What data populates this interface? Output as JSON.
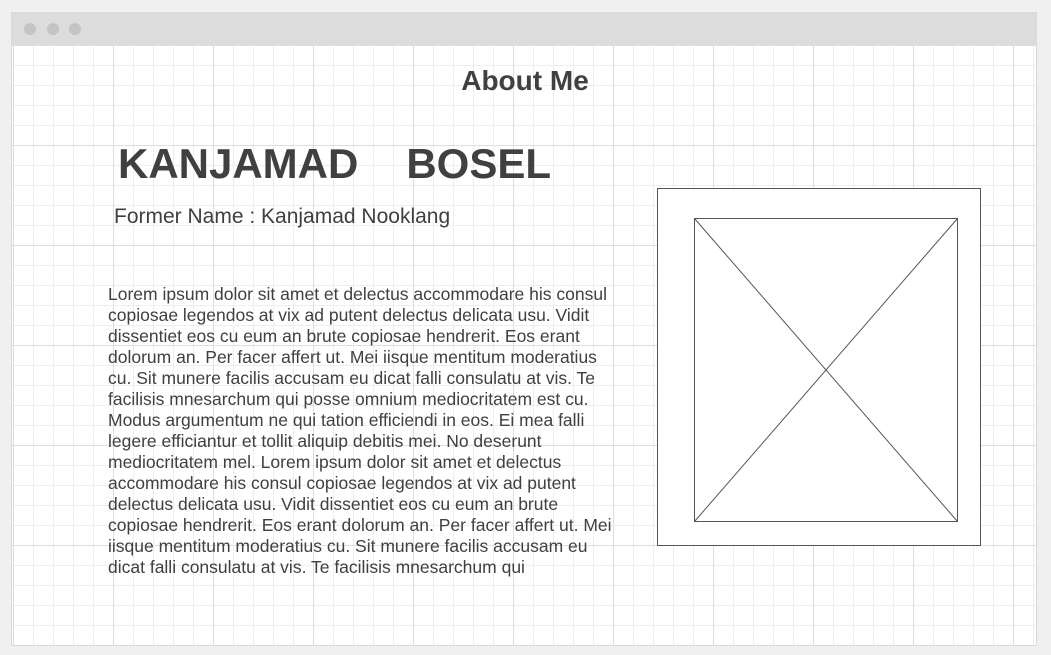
{
  "window": {
    "controls": [
      "window-dot",
      "window-dot",
      "window-dot"
    ]
  },
  "page": {
    "title": "About Me",
    "first_name": "KANJAMAD",
    "last_name": "BOSEL",
    "former_name": "Former Name : Kanjamad Nooklang",
    "bio": "Lorem ipsum dolor sit amet et delectus accommodare his consul copiosae legendos at vix ad putent delectus delicata usu. Vidit dissentiet eos cu eum an brute copiosae hendrerit. Eos erant dolorum an. Per facer affert ut. Mei iisque mentitum moderatius cu. Sit munere facilis accusam eu dicat falli consulatu at vis. Te facilisis mnesarchum qui posse omnium mediocritatem est cu. Modus argumentum ne qui tation efficiendi in eos. Ei mea falli legere efficiantur et tollit aliquip debitis mei. No deserunt mediocritatem mel. Lorem ipsum dolor sit amet et delectus accommodare his consul copiosae legendos at vix ad putent delectus delicata usu. Vidit dissentiet eos cu eum an brute copiosae hendrerit. Eos erant dolorum an. Per facer affert ut. Mei iisque mentitum moderatius cu. Sit munere facilis accusam eu dicat falli consulatu at vis. Te facilisis mnesarchum qui",
    "image_placeholder_icon": "image-placeholder-icon"
  },
  "colors": {
    "text": "#404040",
    "titlebar": "#dcdcdc",
    "dot": "#c4c4c4",
    "grid": "#dedede"
  }
}
